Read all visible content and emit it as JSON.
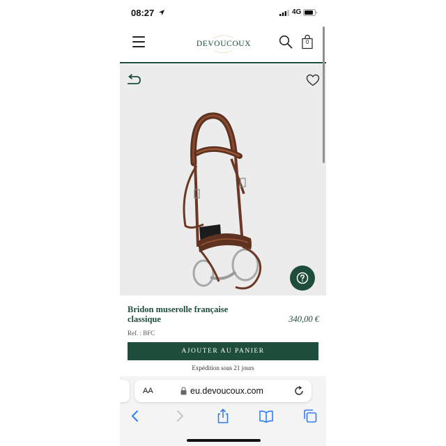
{
  "status_bar": {
    "time": "08:27",
    "network": "4G"
  },
  "header": {
    "logo_text": "DEVOUCOUX",
    "logo_top_arc": "BIARRITZ",
    "logo_bottom_arc": "FRANCE",
    "cart_count": "0"
  },
  "product": {
    "title": "Bridon muserolle française classique",
    "price": "340,00 €",
    "ref": "Ref. : BFC",
    "add_to_cart_label": "AJOUTER AU PANIER",
    "shipping": "Expédition sous 21 jours"
  },
  "browser": {
    "aa_label": "AA",
    "url": "eu.devoucoux.com"
  },
  "colors": {
    "brand_green": "#1e4d3b",
    "leather": "#6e3a26",
    "image_bg": "#ececec"
  },
  "icons": [
    "location-arrow-icon",
    "signal-icon",
    "battery-icon",
    "menu-icon",
    "search-icon",
    "bag-icon",
    "back-arrow-icon",
    "heart-icon",
    "help-icon",
    "lock-icon",
    "reload-icon",
    "back-icon",
    "forward-icon",
    "share-icon",
    "bookmarks-icon",
    "tabs-icon"
  ]
}
